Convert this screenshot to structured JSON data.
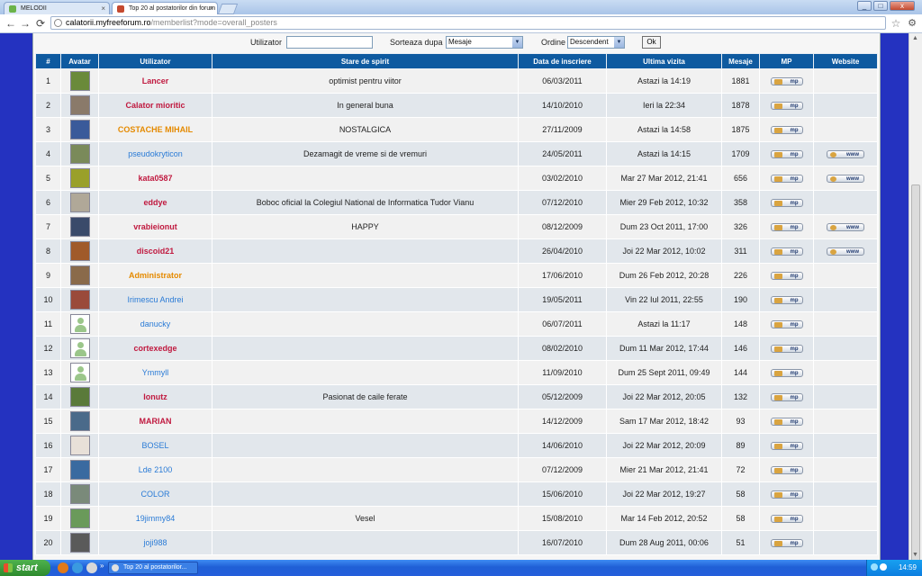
{
  "browser": {
    "tabs": [
      {
        "label": "MELODII"
      },
      {
        "label": "Top 20 al postatorilor din forum"
      }
    ],
    "window_controls": {
      "minimize": "_",
      "maximize": "□",
      "close": "x"
    },
    "url_host": "calatorii.myfreeforum.ro",
    "url_path": "/memberlist?mode=overall_posters",
    "icons": [
      "back-icon",
      "forward-icon",
      "reload-icon",
      "star-icon",
      "wrench-icon"
    ]
  },
  "search": {
    "user_label": "Utilizator",
    "user_value": "",
    "sort_label": "Sorteaza dupa",
    "sort_value": "Mesaje",
    "order_label": "Ordine",
    "order_value": "Descendent",
    "ok_label": "Ok"
  },
  "table": {
    "headers": [
      "#",
      "Avatar",
      "Utilizator",
      "Stare de spirit",
      "Data de inscriere",
      "Ultima vizita",
      "Mesaje",
      "MP",
      "Website"
    ],
    "mp_label": "mp",
    "www_label": "www",
    "rows": [
      {
        "rank": "1",
        "user": "Lancer",
        "user_color": "red",
        "avatar": "#6a8a3a",
        "mood": "optimist pentru viitor",
        "joined": "06/03/2011",
        "last": "Astazi la 14:19",
        "posts": "1881",
        "www": false
      },
      {
        "rank": "2",
        "user": "Calator mioritic",
        "user_color": "red",
        "avatar": "#8a7a6a",
        "mood": "In general buna",
        "joined": "14/10/2010",
        "last": "Ieri la 22:34",
        "posts": "1878",
        "www": false
      },
      {
        "rank": "3",
        "user": "COSTACHE MIHAIL",
        "user_color": "orange",
        "avatar": "#3a5a9a",
        "mood": "NOSTALGICA",
        "joined": "27/11/2009",
        "last": "Astazi la 14:58",
        "posts": "1875",
        "www": false
      },
      {
        "rank": "4",
        "user": "pseudokryticon",
        "user_color": "blue",
        "avatar": "#7a8a5a",
        "mood": "Dezamagit de vreme si de vremuri",
        "joined": "24/05/2011",
        "last": "Astazi la 14:15",
        "posts": "1709",
        "www": true
      },
      {
        "rank": "5",
        "user": "kata0587",
        "user_color": "red",
        "avatar": "#9aa02a",
        "mood": "",
        "joined": "03/02/2010",
        "last": "Mar 27 Mar 2012, 21:41",
        "posts": "656",
        "www": true
      },
      {
        "rank": "6",
        "user": "eddye",
        "user_color": "red",
        "avatar": "#b0a898",
        "mood": "Boboc oficial la Colegiul National de Informatica Tudor Vianu",
        "joined": "07/12/2010",
        "last": "Mier 29 Feb 2012, 10:32",
        "posts": "358",
        "www": false
      },
      {
        "rank": "7",
        "user": "vrabieionut",
        "user_color": "red",
        "avatar": "#3a4a6a",
        "mood": "HAPPY",
        "joined": "08/12/2009",
        "last": "Dum 23 Oct 2011, 17:00",
        "posts": "326",
        "www": true
      },
      {
        "rank": "8",
        "user": "discoid21",
        "user_color": "red",
        "avatar": "#a05a2a",
        "mood": "",
        "joined": "26/04/2010",
        "last": "Joi 22 Mar 2012, 10:02",
        "posts": "311",
        "www": true
      },
      {
        "rank": "9",
        "user": "Administrator",
        "user_color": "orange",
        "avatar": "#8a6a4a",
        "mood": "",
        "joined": "17/06/2010",
        "last": "Dum 26 Feb 2012, 20:28",
        "posts": "226",
        "www": false
      },
      {
        "rank": "10",
        "user": "Irimescu Andrei",
        "user_color": "blue",
        "avatar": "#9a4a3a",
        "mood": "",
        "joined": "19/05/2011",
        "last": "Vin 22 Iul 2011, 22:55",
        "posts": "190",
        "www": false
      },
      {
        "rank": "11",
        "user": "danucky",
        "user_color": "blue",
        "avatar": "default",
        "mood": "",
        "joined": "06/07/2011",
        "last": "Astazi la 11:17",
        "posts": "148",
        "www": false
      },
      {
        "rank": "12",
        "user": "cortexedge",
        "user_color": "red",
        "avatar": "default",
        "mood": "",
        "joined": "08/02/2010",
        "last": "Dum 11 Mar 2012, 17:44",
        "posts": "146",
        "www": false
      },
      {
        "rank": "13",
        "user": "Ymmyll",
        "user_color": "blue",
        "avatar": "default",
        "mood": "",
        "joined": "11/09/2010",
        "last": "Dum 25 Sept 2011, 09:49",
        "posts": "144",
        "www": false
      },
      {
        "rank": "14",
        "user": "Ionutz",
        "user_color": "red",
        "avatar": "#5a7a3a",
        "mood": "Pasionat de caile ferate",
        "joined": "05/12/2009",
        "last": "Joi 22 Mar 2012, 20:05",
        "posts": "132",
        "www": false
      },
      {
        "rank": "15",
        "user": "MARIAN",
        "user_color": "red",
        "avatar": "#4a6a8a",
        "mood": "",
        "joined": "14/12/2009",
        "last": "Sam 17 Mar 2012, 18:42",
        "posts": "93",
        "www": false
      },
      {
        "rank": "16",
        "user": "BOSEL",
        "user_color": "blue",
        "avatar": "#e8e0d8",
        "mood": "",
        "joined": "14/06/2010",
        "last": "Joi 22 Mar 2012, 20:09",
        "posts": "89",
        "www": false
      },
      {
        "rank": "17",
        "user": "Lde 2100",
        "user_color": "blue",
        "avatar": "#3a6aa0",
        "mood": "",
        "joined": "07/12/2009",
        "last": "Mier 21 Mar 2012, 21:41",
        "posts": "72",
        "www": false
      },
      {
        "rank": "18",
        "user": "COLOR",
        "user_color": "blue",
        "avatar": "#7a8a7a",
        "mood": "",
        "joined": "15/06/2010",
        "last": "Joi 22 Mar 2012, 19:27",
        "posts": "58",
        "www": false
      },
      {
        "rank": "19",
        "user": "19jimmy84",
        "user_color": "blue",
        "avatar": "#6a9a5a",
        "mood": "Vesel",
        "joined": "15/08/2010",
        "last": "Mar 14 Feb 2012, 20:52",
        "posts": "58",
        "www": false
      },
      {
        "rank": "20",
        "user": "joji988",
        "user_color": "blue",
        "avatar": "#5a5a5a",
        "mood": "",
        "joined": "16/07/2010",
        "last": "Dum 28 Aug 2011, 00:06",
        "posts": "51",
        "www": false
      }
    ]
  },
  "taskbar": {
    "start_label": "start",
    "task_label": "Top 20 al postatorilor...",
    "quicklaunch_more": "»",
    "clock": "14:59"
  },
  "colors": {
    "page_bg": "#2432c0",
    "header_bg": "#0e5aa0",
    "user_red": "#c0193f",
    "user_orange": "#e58a00",
    "user_blue": "#2a7bd6"
  }
}
